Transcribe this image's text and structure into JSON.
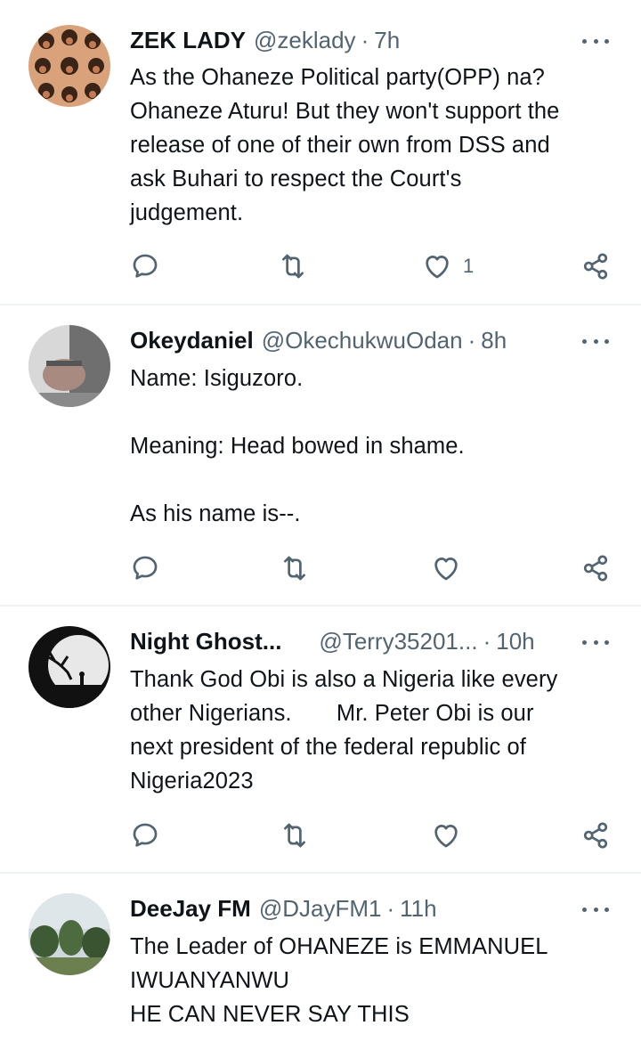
{
  "tweets": [
    {
      "name": "ZEK LADY",
      "handle": "@zeklady",
      "time": "7h",
      "text": "As the Ohaneze Political party(OPP) na?\nOhaneze Aturu! But they won't support the\nrelease of one of their own from DSS and\nask Buhari to respect the Court's\njudgement.",
      "likes": "1"
    },
    {
      "name": "Okeydaniel",
      "handle": "@OkechukwuOdan",
      "time": "8h",
      "text": "Name: Isiguzoro.\n\nMeaning: Head bowed in shame.\n\nAs his name is--.",
      "likes": ""
    },
    {
      "name": "Night Ghost...",
      "handle": "@Terry35201...",
      "time": "10h",
      "text": "Thank God Obi is also a Nigeria like every\nother Nigerians.       Mr. Peter Obi is our\nnext president of the federal republic of\nNigeria2023",
      "likes": ""
    },
    {
      "name": "DeeJay FM",
      "handle": "@DJayFM1",
      "time": "11h",
      "text": "The Leader of OHANEZE is EMMANUEL\nIWUANYANWU\nHE CAN NEVER SAY THIS",
      "likes": ""
    }
  ],
  "colors": {
    "text": "#0f1419",
    "secondary": "#536471",
    "divider": "#eff3f4"
  },
  "icons": [
    "reply-icon",
    "retweet-icon",
    "like-icon",
    "share-icon",
    "more-icon"
  ]
}
